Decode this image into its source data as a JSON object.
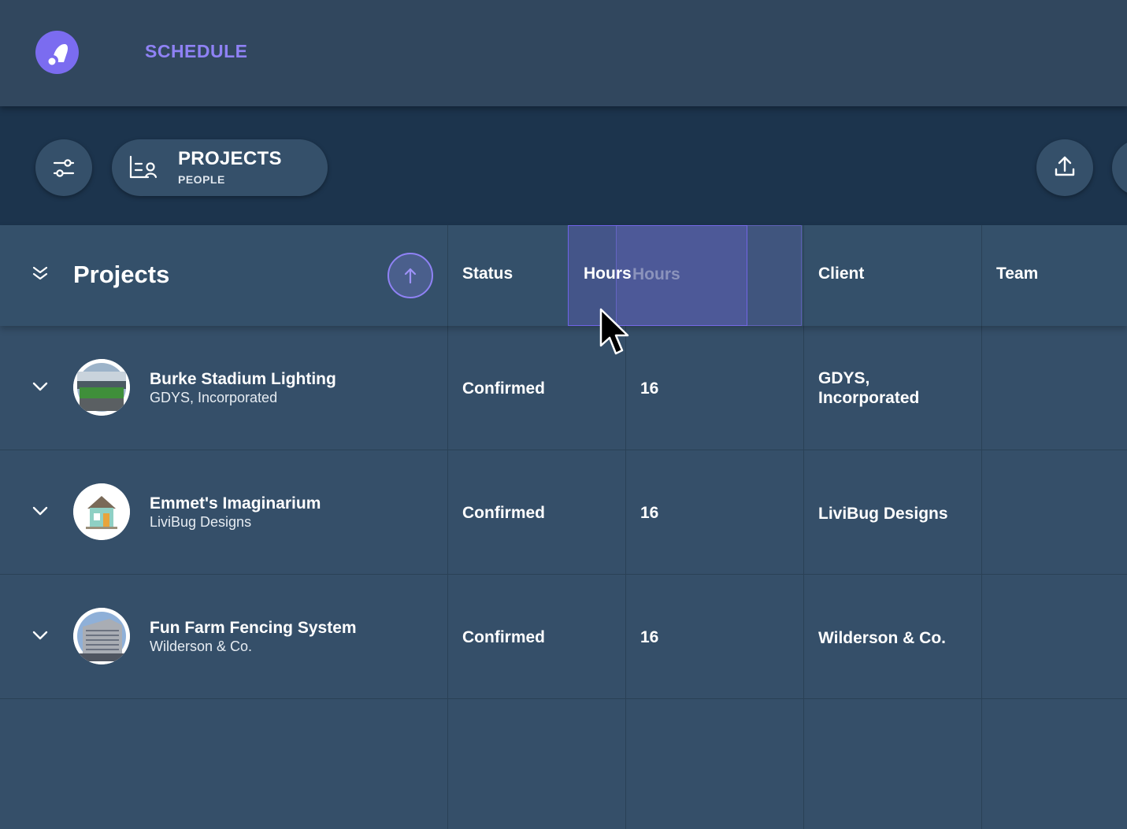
{
  "nav": {
    "title": "SCHEDULE"
  },
  "toolbar": {
    "view_primary": "PROJECTS",
    "view_secondary": "PEOPLE"
  },
  "table": {
    "title": "Projects",
    "columns": {
      "status": "Status",
      "hours": "Hours",
      "hours_ghost": "Hours",
      "client": "Client",
      "team": "Team"
    },
    "rows": [
      {
        "name": "Burke Stadium Lighting",
        "client_sub": "GDYS, Incorporated",
        "status": "Confirmed",
        "hours": "16",
        "client_line1": "GDYS,",
        "client_line2": "Incorporated",
        "thumb": "stadium-thumbnail"
      },
      {
        "name": "Emmet's Imaginarium",
        "client_sub": "LiviBug Designs",
        "status": "Confirmed",
        "hours": "16",
        "client_line1": "LiviBug Designs",
        "client_line2": "",
        "thumb": "playhouse-thumbnail"
      },
      {
        "name": "Fun Farm Fencing System",
        "client_sub": "Wilderson & Co.",
        "status": "Confirmed",
        "hours": "16",
        "client_line1": "Wilderson & Co.",
        "client_line2": "",
        "thumb": "building-thumbnail"
      }
    ]
  },
  "colors": {
    "accent": "#7b6cf0",
    "nav_text": "#8f82f5",
    "toolbar_bg": "#1c344d",
    "table_bg": "#354f69"
  },
  "icons": [
    "logo-icon",
    "filter-sliders-icon",
    "projects-people-icon",
    "upload-icon",
    "collapse-all-icon",
    "sort-up-arrow-icon",
    "chevron-down-icon",
    "mouse-cursor-icon"
  ]
}
